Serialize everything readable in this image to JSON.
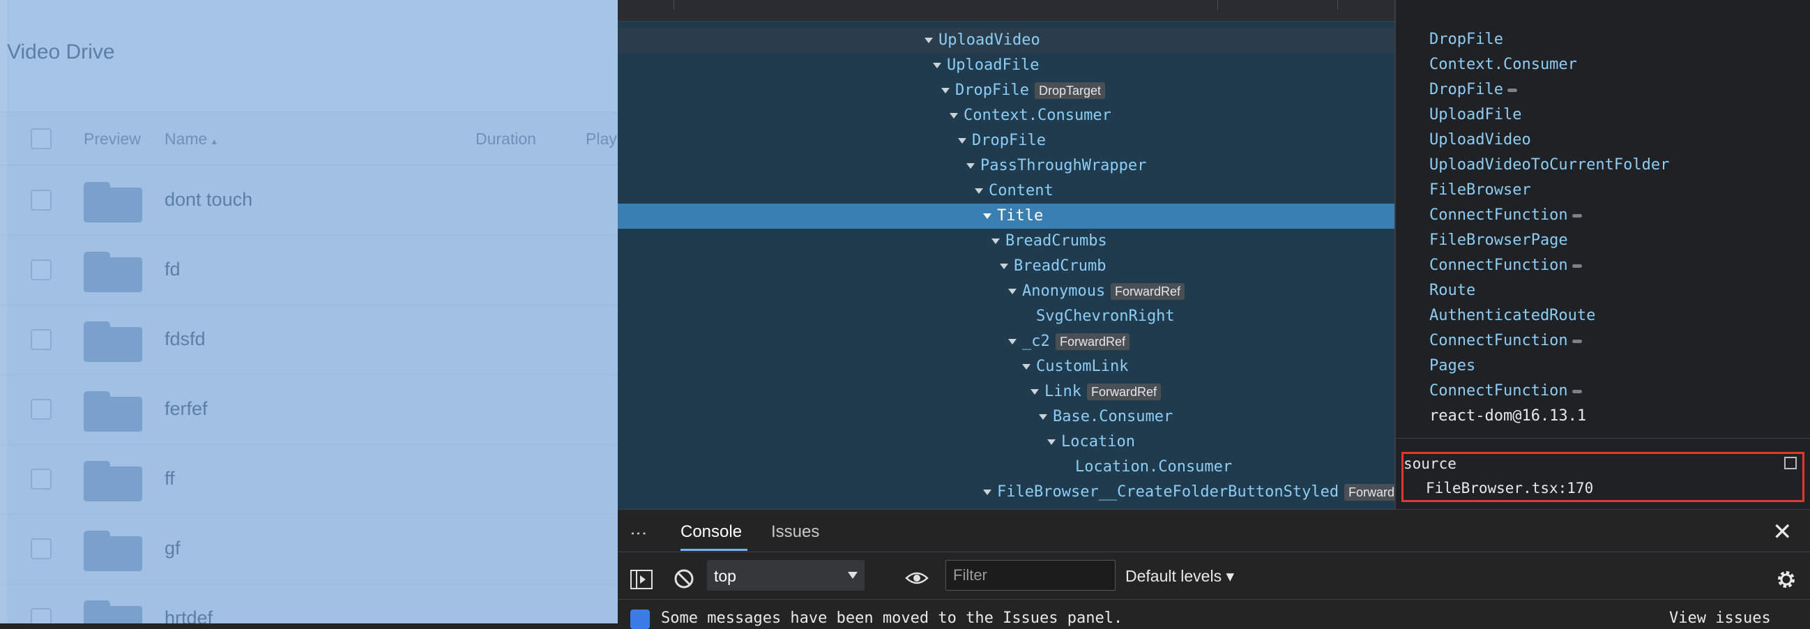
{
  "app": {
    "title": "Video Drive",
    "columns": {
      "preview": "Preview",
      "name": "Name",
      "name_sort": "▴",
      "duration": "Duration",
      "play": "Play"
    },
    "rows": [
      {
        "name": "dont touch"
      },
      {
        "name": "fd"
      },
      {
        "name": "fdsfd"
      },
      {
        "name": "ferfef"
      },
      {
        "name": "ff"
      },
      {
        "name": "gf"
      },
      {
        "name": "hrtdef"
      }
    ]
  },
  "devtools": {
    "tree": [
      {
        "label": "UploadVideo",
        "state": "hover"
      },
      {
        "label": "UploadFile"
      },
      {
        "label": "DropFile",
        "badge": "DropTarget"
      },
      {
        "label": "Context.Consumer"
      },
      {
        "label": "DropFile"
      },
      {
        "label": "PassThroughWrapper"
      },
      {
        "label": "Content"
      },
      {
        "label": "Title",
        "state": "selected"
      },
      {
        "label": "BreadCrumbs"
      },
      {
        "label": "BreadCrumb"
      },
      {
        "label": "Anonymous",
        "badge": "ForwardRef"
      },
      {
        "label": "SvgChevronRight"
      },
      {
        "label": "_c2",
        "badge": "ForwardRef"
      },
      {
        "label": "CustomLink"
      },
      {
        "label": "Link",
        "badge": "ForwardRef"
      },
      {
        "label": "Base.Consumer"
      },
      {
        "label": "Location"
      },
      {
        "label": "Location.Consumer"
      },
      {
        "label": "FileBrowser__CreateFolderButtonStyled",
        "badge": "ForwardRef"
      }
    ],
    "rendered_by": [
      {
        "label": "DropFile"
      },
      {
        "label": "Context.Consumer"
      },
      {
        "label": "DropFile",
        "dot": true
      },
      {
        "label": "UploadFile"
      },
      {
        "label": "UploadVideo"
      },
      {
        "label": "UploadVideoToCurrentFolder"
      },
      {
        "label": "FileBrowser"
      },
      {
        "label": "ConnectFunction",
        "dot": true
      },
      {
        "label": "FileBrowserPage"
      },
      {
        "label": "ConnectFunction",
        "dot": true
      },
      {
        "label": "Route"
      },
      {
        "label": "AuthenticatedRoute"
      },
      {
        "label": "ConnectFunction",
        "dot": true
      },
      {
        "label": "Pages"
      },
      {
        "label": "ConnectFunction",
        "dot": true
      },
      {
        "label": "react-dom@16.13.1",
        "plain": true
      }
    ],
    "source": {
      "heading": "source",
      "value": "FileBrowser.tsx:170"
    },
    "drawer": {
      "more": "⋮",
      "tabs": [
        "Console",
        "Issues"
      ],
      "context": "top",
      "filter_placeholder": "Filter",
      "levels": "Default levels ▾",
      "message": "Some messages have been moved to the Issues panel.",
      "view_issues": "View issues",
      "close": "✕"
    }
  }
}
